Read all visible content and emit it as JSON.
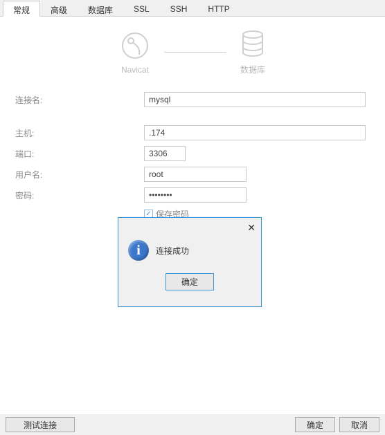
{
  "tabs": {
    "general": "常规",
    "advanced": "高级",
    "database": "数据库",
    "ssl": "SSL",
    "ssh": "SSH",
    "http": "HTTP"
  },
  "header": {
    "navicat_label": "Navicat",
    "db_label": "数据库"
  },
  "form": {
    "connection_name_label": "连接名:",
    "connection_name_value": "mysql",
    "host_label": "主机:",
    "host_value": ".174",
    "port_label": "端口:",
    "port_value": "3306",
    "username_label": "用户名:",
    "username_value": "root",
    "password_label": "密码:",
    "password_value": "••••••••",
    "save_password_label": "保存密码"
  },
  "dialog": {
    "message": "连接成功",
    "ok_label": "确定"
  },
  "footer": {
    "test_label": "测试连接",
    "ok_label": "确定",
    "cancel_label": "取消"
  }
}
